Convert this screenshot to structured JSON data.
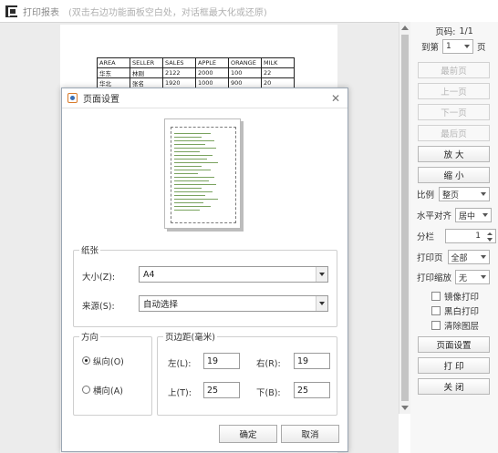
{
  "window": {
    "title": "打印报表",
    "hint": "(双击右边功能面板空白处，对话框最大化或还原)"
  },
  "report": {
    "rows": [
      [
        "AREA",
        "SELLER",
        "SALES",
        "APPLE",
        "ORANGE",
        "MILK"
      ],
      [
        "华东",
        "林刚",
        "2122",
        "2000",
        "100",
        "22"
      ],
      [
        "华北",
        "张名",
        "1920",
        "1000",
        "900",
        "20"
      ]
    ]
  },
  "panel": {
    "page_label": "页码:",
    "page_value": "1/1",
    "goto_label": "到第",
    "goto_value": "1",
    "goto_suffix": "页",
    "first": "最前页",
    "prev": "上一页",
    "next": "下一页",
    "last": "最后页",
    "zoom_in": "放 大",
    "zoom_out": "缩 小",
    "scale_label": "比例",
    "scale_value": "整页",
    "halign_label": "水平对齐",
    "halign_value": "居中",
    "columns_label": "分栏",
    "columns_value": "1",
    "print_pages_label": "打印页",
    "print_pages_value": "全部",
    "print_scale_label": "打印缩放",
    "print_scale_value": "无",
    "mirror": "镜像打印",
    "bw": "黑白打印",
    "clear_layers": "清除图层",
    "page_setup": "页面设置",
    "print": "打 印",
    "close": "关 闭"
  },
  "dialog": {
    "title": "页面设置",
    "paper_group": "纸张",
    "size_label": "大小(Z):",
    "size_value": "A4",
    "source_label": "来源(S):",
    "source_value": "自动选择",
    "orientation_group": "方向",
    "portrait": "纵向(O)",
    "landscape": "横向(A)",
    "margins_group": "页边距(毫米)",
    "left_label": "左(L):",
    "left_value": "19",
    "right_label": "右(R):",
    "right_value": "19",
    "top_label": "上(T):",
    "top_value": "25",
    "bottom_label": "下(B):",
    "bottom_value": "25",
    "ok": "确定",
    "cancel": "取消"
  },
  "icons": [
    "app-icon",
    "java-icon",
    "close-icon",
    "chevron-down-icon"
  ]
}
